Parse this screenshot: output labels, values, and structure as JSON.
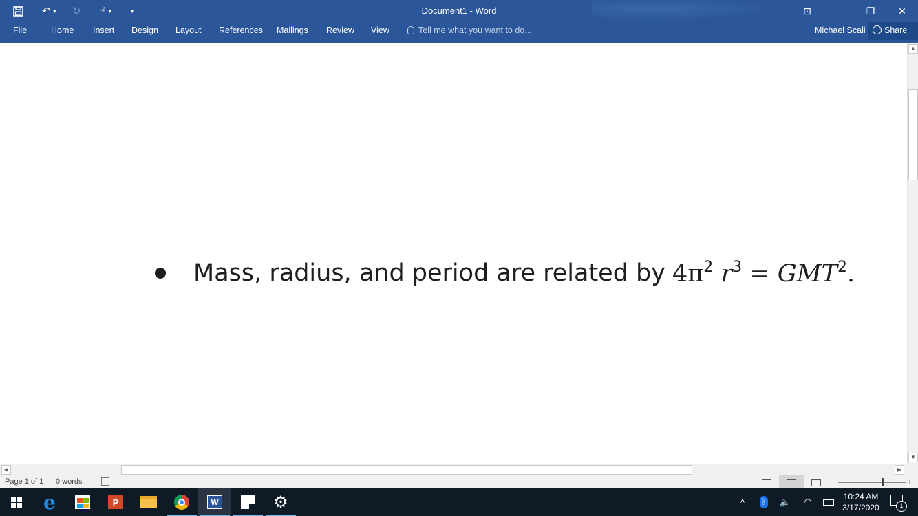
{
  "app": {
    "window_title": "Document1 - Word"
  },
  "ribbon": {
    "tabs": [
      {
        "label": "File"
      },
      {
        "label": "Home"
      },
      {
        "label": "Insert"
      },
      {
        "label": "Design"
      },
      {
        "label": "Layout"
      },
      {
        "label": "References"
      },
      {
        "label": "Mailings"
      },
      {
        "label": "Review"
      },
      {
        "label": "View"
      }
    ],
    "tell_me_placeholder": "Tell me what you want to do...",
    "user_name": "Michael Scali",
    "share_label": "Share"
  },
  "document": {
    "bullet_text": "Mass, radius, and period are related by",
    "equation": {
      "lhs_coef": "4",
      "pi": "π",
      "pi_exp": "2",
      "r": "r",
      "r_exp": "3",
      "equals": "=",
      "rhs": "GMT",
      "rhs_exp": "2",
      "period": "."
    }
  },
  "status_bar": {
    "page": "Page 1 of 1",
    "words": "0 words"
  },
  "taskbar": {
    "apps": [
      "start-icon",
      "edge-icon",
      "store-icon",
      "powerpoint-icon",
      "file-explorer-icon",
      "chrome-icon",
      "word-icon",
      "sticky-notes-icon",
      "settings-icon"
    ],
    "time": "10:24 AM",
    "date": "3/17/2020",
    "notification_count": "1"
  }
}
